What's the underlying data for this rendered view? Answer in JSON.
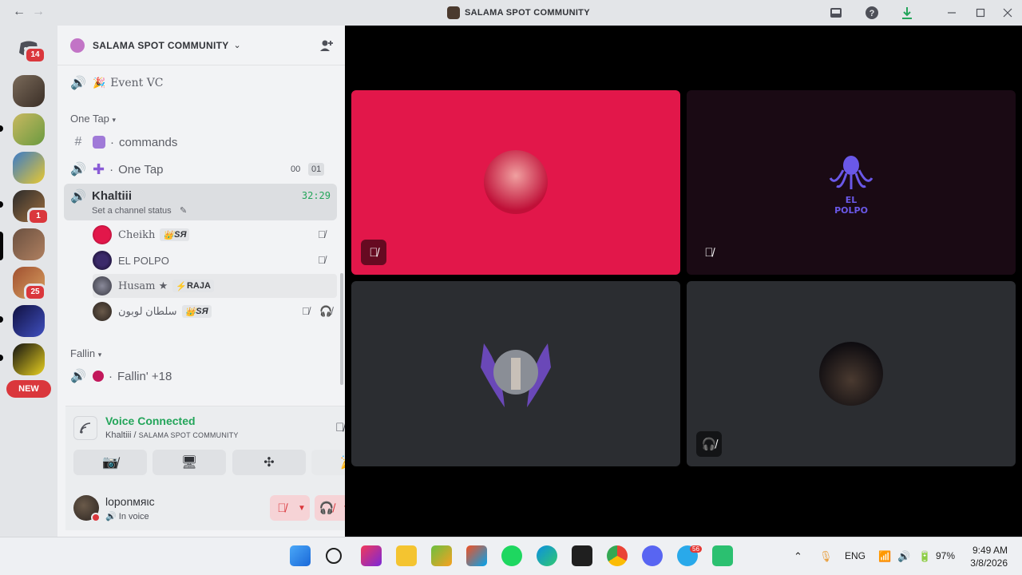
{
  "titlebar": {
    "title": "SALAMA SPOT COMMUNITY",
    "back": "←",
    "forward": "→"
  },
  "rail": {
    "home_badge": "14",
    "badges": [
      "1",
      "25"
    ],
    "new_label": "NEW"
  },
  "server": {
    "name": "SALAMA SPOT COMMUNITY",
    "chevron": "⌄"
  },
  "channels": {
    "event": {
      "name": "Event VC",
      "emoji": "🎉"
    },
    "cat_one_tap": "One Tap",
    "commands": {
      "name": "commands",
      "prefix": "·"
    },
    "one_tap": {
      "name": "One Tap",
      "prefix": "·",
      "count_a": "00",
      "count_b": "01"
    },
    "active": {
      "name": "Khaltiii",
      "timer": "32:29",
      "status": "Set a channel status"
    },
    "cat_fallin": "Fallin",
    "fallin": {
      "name": "Fallin' +18",
      "prefix": "·"
    }
  },
  "members": [
    {
      "name": "Cheikh",
      "tag": "SЯ"
    },
    {
      "name": "EL POLPO",
      "tag": ""
    },
    {
      "name": "Husam ★",
      "tag": "RAJA"
    },
    {
      "name": "سلطان لوبون",
      "tag": "SЯ"
    }
  ],
  "voice": {
    "title": "Voice Connected",
    "channel": "Khaltiii / ",
    "server": "SALAMA SPOT COMMUNITY"
  },
  "user": {
    "name": "loponмяιc",
    "state": "In voice"
  },
  "stage": {
    "elpolpo_label": "EL POLPO"
  },
  "taskbar": {
    "lang": "ENG",
    "battery": "97%",
    "time": "9:49 AM",
    "date": "3/8/2026",
    "telegram_badge": "56"
  },
  "colors": {
    "accent_green": "#23a55a",
    "danger_red": "#da373c",
    "tile_pink": "#e2174a",
    "tile_dark": "#1a0a14",
    "tile_grey": "#2b2d31"
  }
}
